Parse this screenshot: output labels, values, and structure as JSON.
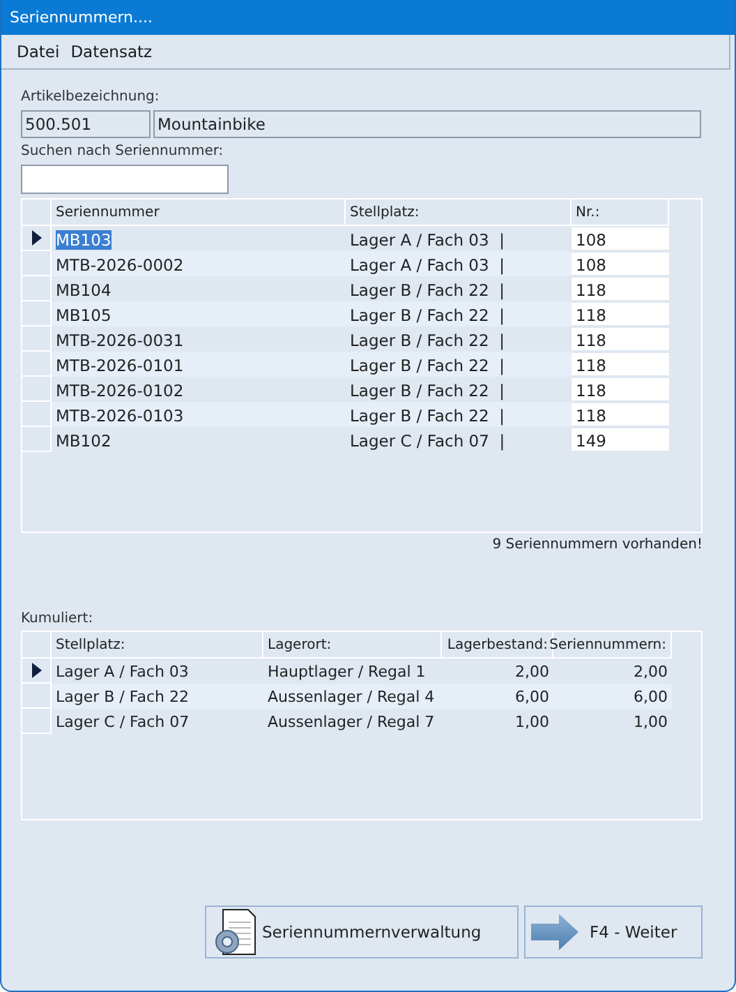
{
  "window": {
    "title": "Seriennummern...."
  },
  "menu": [
    "Datei",
    "Datensatz"
  ],
  "article": {
    "label": "Artikelbezeichnung:",
    "number": "500.501",
    "name": "Mountainbike"
  },
  "search": {
    "label": "Suchen nach Seriennummer:"
  },
  "serials": {
    "columns": [
      "Seriennummer",
      "Stellplatz:",
      "Nr.:"
    ],
    "rows": [
      {
        "selected": true,
        "cells": [
          "MB103",
          "Lager A / Fach 03  |",
          "108"
        ]
      },
      {
        "selected": false,
        "cells": [
          "MTB-2026-0002",
          "Lager A / Fach 03  |",
          "108"
        ]
      },
      {
        "selected": false,
        "cells": [
          "MB104",
          "Lager B / Fach 22  |",
          "118"
        ]
      },
      {
        "selected": false,
        "cells": [
          "MB105",
          "Lager B / Fach 22  |",
          "118"
        ]
      },
      {
        "selected": false,
        "cells": [
          "MTB-2026-0031",
          "Lager B / Fach 22  |",
          "118"
        ]
      },
      {
        "selected": false,
        "cells": [
          "MTB-2026-0101",
          "Lager B / Fach 22  |",
          "118"
        ]
      },
      {
        "selected": false,
        "cells": [
          "MTB-2026-0102",
          "Lager B / Fach 22  |",
          "118"
        ]
      },
      {
        "selected": false,
        "cells": [
          "MTB-2026-0103",
          "Lager B / Fach 22  |",
          "118"
        ]
      },
      {
        "selected": false,
        "cells": [
          "MB102",
          "Lager C / Fach 07  |",
          "149"
        ]
      }
    ]
  },
  "count_text": "9 Seriennummern vorhanden!",
  "cumulative": {
    "label": "Kumuliert:",
    "columns": [
      "Stellplatz:",
      "Lagerort:",
      "Lagerbestand:",
      "Seriennummern:"
    ],
    "rows": [
      {
        "selected": true,
        "cells": [
          "Lager A / Fach 03",
          "Hauptlager / Regal 1",
          "2,00",
          "2,00"
        ]
      },
      {
        "selected": false,
        "cells": [
          "Lager B / Fach 22",
          "Aussenlager / Regal 4",
          "6,00",
          "6,00"
        ]
      },
      {
        "selected": false,
        "cells": [
          "Lager C / Fach 07",
          "Aussenlager / Regal 7",
          "1,00",
          "1,00"
        ]
      }
    ]
  },
  "buttons": [
    {
      "kind": "manage",
      "label": "Seriennummernverwaltung"
    },
    {
      "kind": "next",
      "label": "F4 - Weiter"
    }
  ]
}
